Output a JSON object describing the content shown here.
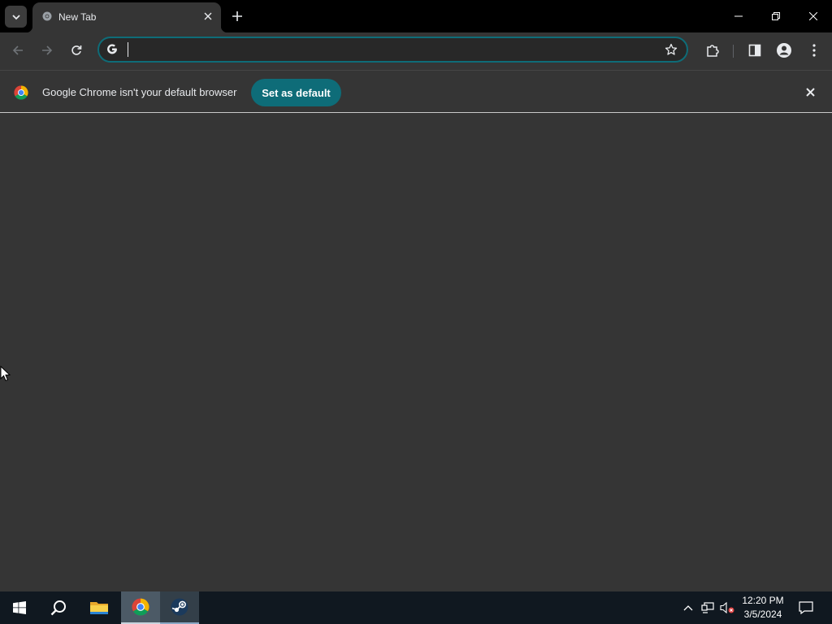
{
  "tabstrip": {
    "tab_search_icon": "chevron-down-icon",
    "tabs": [
      {
        "title": "New Tab",
        "favicon": "chrome-icon",
        "close_icon": "close-icon"
      }
    ],
    "new_tab_icon": "plus-icon",
    "window_controls": [
      "minimize-icon",
      "restore-icon",
      "close-icon"
    ]
  },
  "toolbar": {
    "back_icon": "back-arrow-icon",
    "forward_icon": "forward-arrow-icon",
    "reload_icon": "reload-icon",
    "omnibox": {
      "value": "",
      "leading_icon": "google-g-icon",
      "bookmark_icon": "star-icon"
    },
    "right_icons": [
      "extensions-icon",
      "side-panel-icon",
      "profile-icon",
      "more-vert-icon"
    ]
  },
  "infobar": {
    "message": "Google Chrome isn't your default browser",
    "button_label": "Set as default",
    "close_icon": "close-icon"
  },
  "taskbar": {
    "items": [
      "windows-start-icon",
      "search-icon",
      "file-explorer-icon",
      "chrome-icon",
      "steam-icon"
    ],
    "active": [
      "chrome",
      "steam"
    ],
    "tray_icons": [
      "chevron-up-icon",
      "network-icon",
      "volume-muted-icon"
    ],
    "clock": {
      "time": "12:20 PM",
      "date": "3/5/2024"
    },
    "notifications_icon": "notification-icon"
  },
  "colors": {
    "tabstrip_bg": "#000000",
    "toolbar_bg": "#353535",
    "accent": "#0e6c78",
    "taskbar_bg": "#101820"
  }
}
